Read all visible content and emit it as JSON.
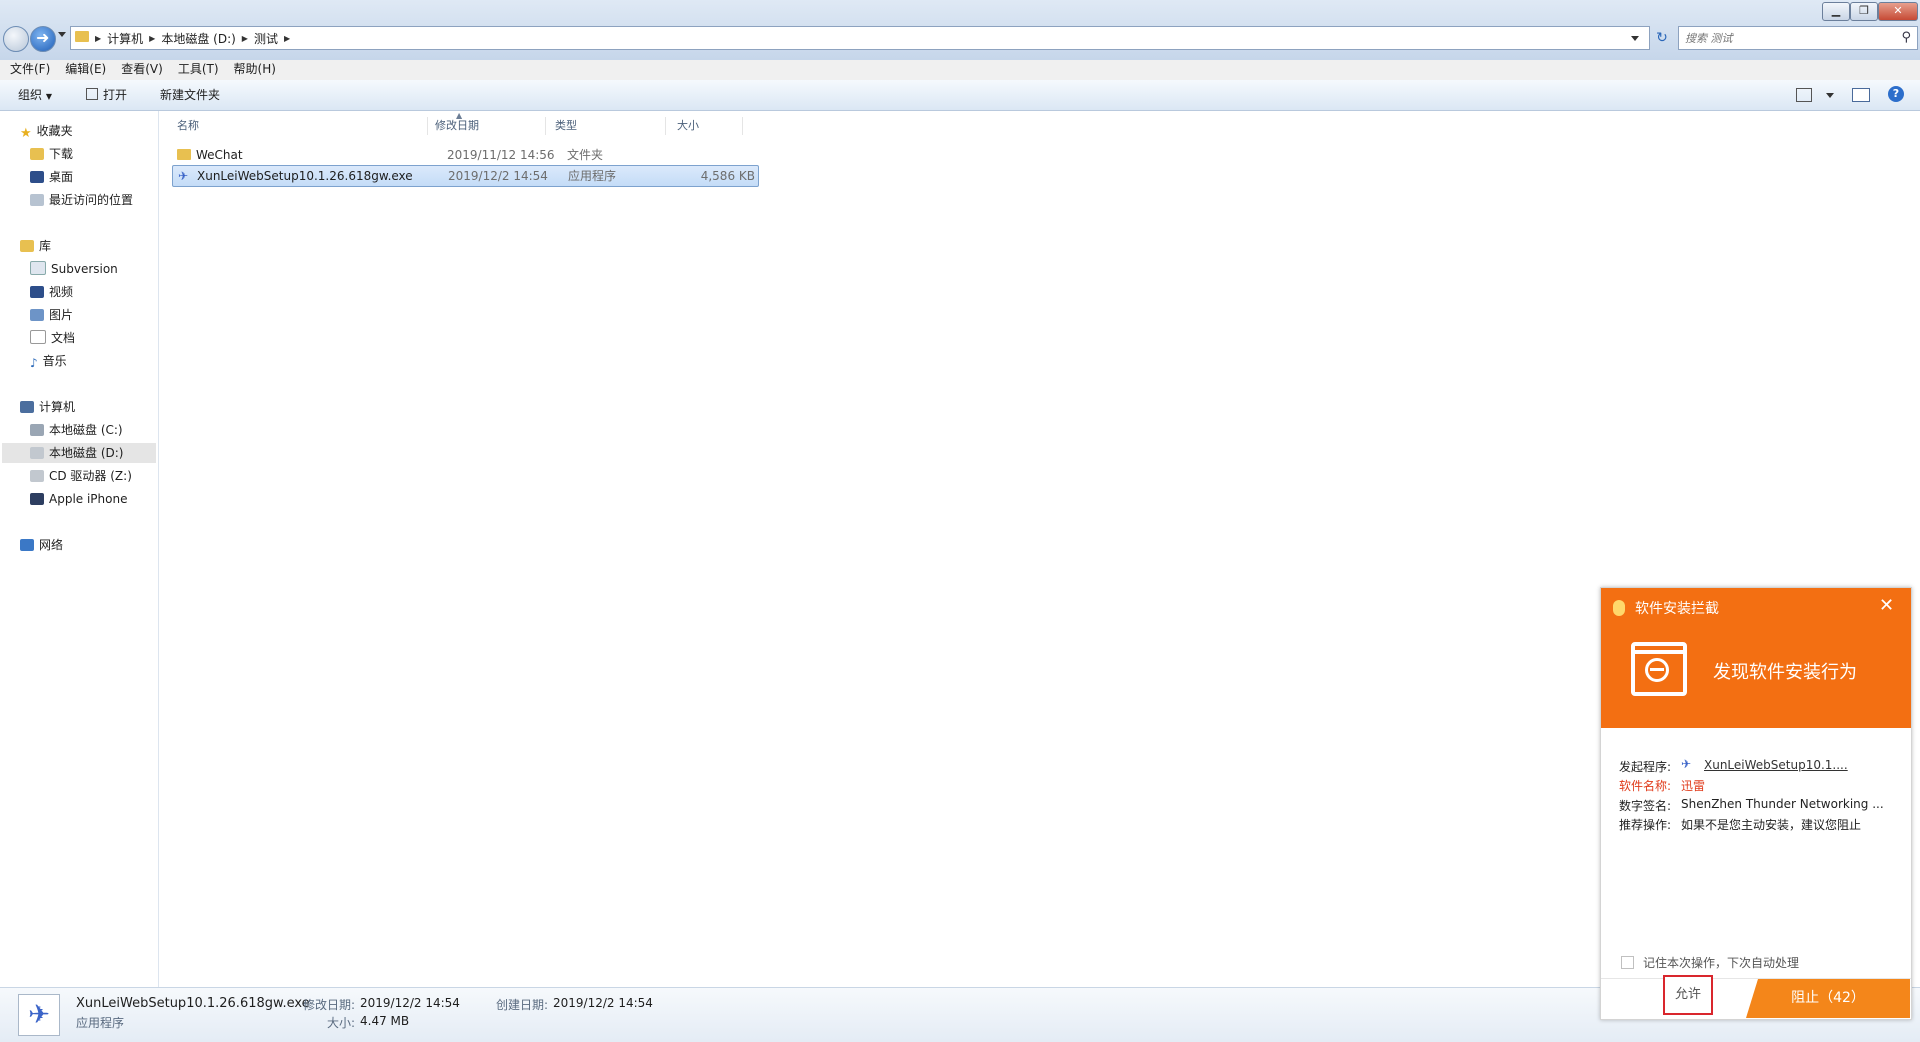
{
  "address": {
    "crumbs": [
      "计算机",
      "本地磁盘 (D:)",
      "测试"
    ],
    "search_placeholder": "搜索 测试"
  },
  "menu": [
    "文件(F)",
    "编辑(E)",
    "查看(V)",
    "工具(T)",
    "帮助(H)"
  ],
  "toolbar": {
    "organize": "组织",
    "open": "打开",
    "new_folder": "新建文件夹"
  },
  "nav": {
    "favorites": {
      "label": "收藏夹",
      "items": [
        "下载",
        "桌面",
        "最近访问的位置"
      ]
    },
    "libraries": {
      "label": "库",
      "items": [
        "Subversion",
        "视频",
        "图片",
        "文档",
        "音乐"
      ]
    },
    "computer": {
      "label": "计算机",
      "items": [
        "本地磁盘 (C:)",
        "本地磁盘 (D:)",
        "CD 驱动器 (Z:)",
        "Apple iPhone"
      ]
    },
    "network": {
      "label": "网络"
    }
  },
  "columns": {
    "name": "名称",
    "modified": "修改日期",
    "type": "类型",
    "size": "大小"
  },
  "files": [
    {
      "name": "WeChat",
      "modified": "2019/11/12 14:56",
      "type": "文件夹",
      "size": ""
    },
    {
      "name": "XunLeiWebSetup10.1.26.618gw.exe",
      "modified": "2019/12/2 14:54",
      "type": "应用程序",
      "size": "4,586 KB"
    }
  ],
  "details": {
    "filename": "XunLeiWebSetup10.1.26.618gw.exe",
    "kind": "应用程序",
    "modified_label": "修改日期:",
    "modified": "2019/12/2 14:54",
    "size_label": "大小:",
    "size": "4.47 MB",
    "created_label": "创建日期:",
    "created": "2019/12/2 14:54"
  },
  "popup": {
    "title": "软件安装拦截",
    "headline": "发现软件安装行为",
    "launcher_label": "发起程序:",
    "launcher_value": "XunLeiWebSetup10.1....",
    "software_label": "软件名称:",
    "software_value": "迅雷",
    "signature_label": "数字签名:",
    "signature_value": "ShenZhen Thunder Networking ...",
    "action_label": "推荐操作:",
    "action_value": "如果不是您主动安装，建议您阻止",
    "remember": "记住本次操作，下次自动处理",
    "allow": "允许",
    "block": "阻止（42）",
    "accent_color": "#f36f12"
  }
}
